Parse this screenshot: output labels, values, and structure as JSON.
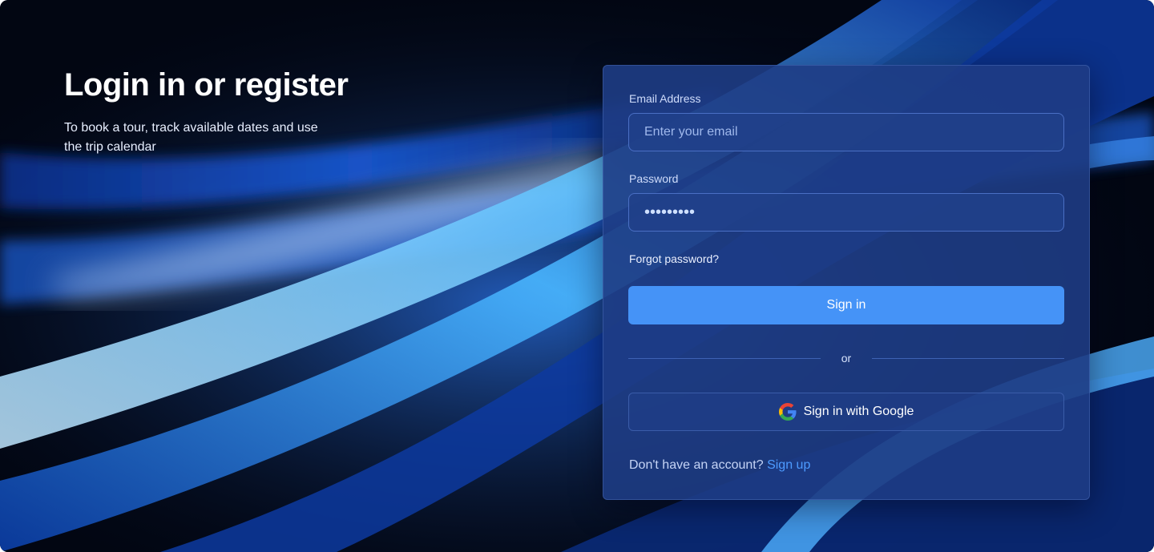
{
  "hero": {
    "title": "Login in or register",
    "subtitle": "To book a tour, track available dates and use the trip calendar"
  },
  "form": {
    "email": {
      "label": "Email Address",
      "placeholder": "Enter your email"
    },
    "password": {
      "label": "Password",
      "value": "•••••••••"
    },
    "forgot_label": "Forgot password?",
    "signin_label": "Sign in",
    "divider_label": "or",
    "google_label": "Sign in with Google",
    "footer_text": "Don't have an account?",
    "signup_label": "Sign up"
  },
  "icons": {
    "google": "google-icon"
  },
  "colors": {
    "primary_button": "#4593f7",
    "card_background": "#1e3c84",
    "link": "#4d9bff",
    "page_background": "#020612"
  }
}
